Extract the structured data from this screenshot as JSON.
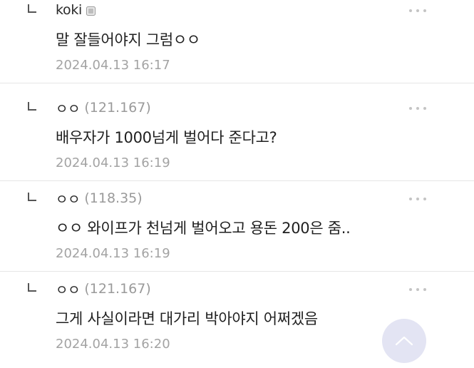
{
  "comments": [
    {
      "nickname": "koki",
      "ip": "",
      "content": "말 잘들어야지 그럼ㅇㅇ",
      "date": "2024.04.13 16:17"
    },
    {
      "nickname": "ㅇㅇ",
      "ip": "(121.167)",
      "content": "배우자가 1000넘게 벌어다 준다고?",
      "date": "2024.04.13 16:19"
    },
    {
      "nickname": "ㅇㅇ",
      "ip": "(118.35)",
      "content": "ㅇㅇ 와이프가 천넘게 벌어오고 용돈 200은 줌..",
      "date": "2024.04.13 16:19"
    },
    {
      "nickname": "ㅇㅇ",
      "ip": "(121.167)",
      "content": "그게 사실이라면 대가리 박아야지 어쩌겠음",
      "date": "2024.04.13 16:20"
    }
  ],
  "icons": {
    "reply": "reply-arrow-icon",
    "more": "more-dots-icon",
    "badge": "member-badge-icon",
    "scroll_top": "chevron-up-icon"
  },
  "colors": {
    "text": "#1f1f1f",
    "meta": "#a3a3a3",
    "divider": "#e6e6e6",
    "scroll_button": "#e3e4f3"
  }
}
